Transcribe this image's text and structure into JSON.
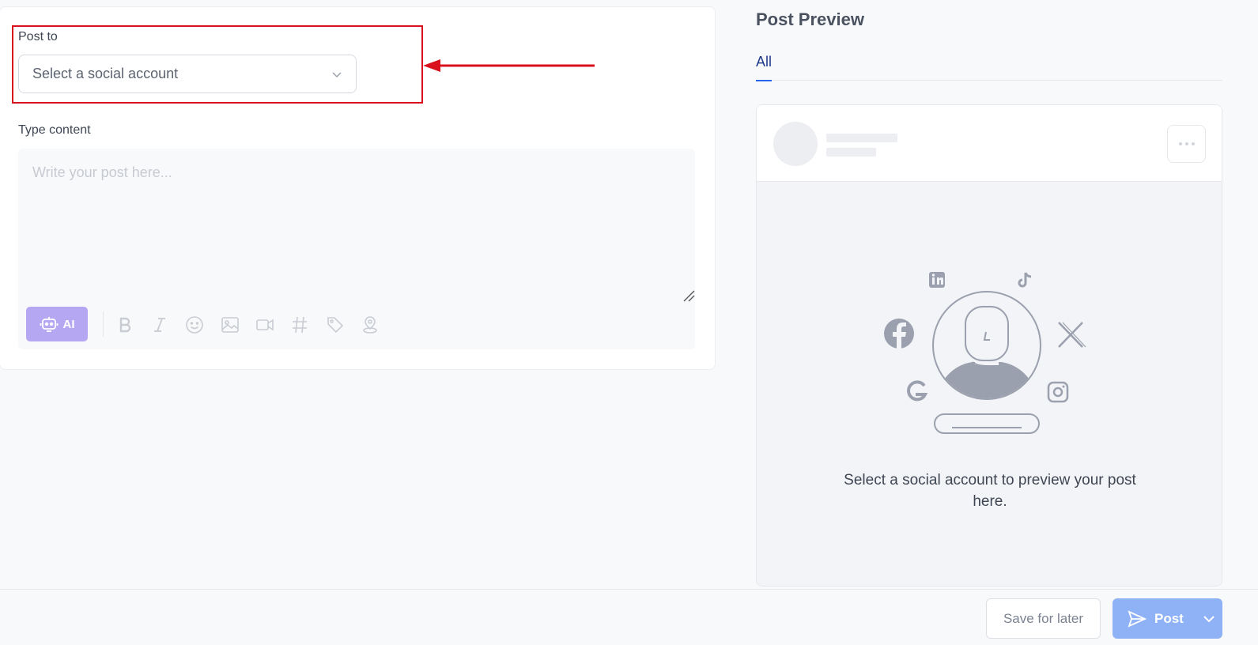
{
  "composer": {
    "post_to_label": "Post to",
    "account_select_value": "Select a social account",
    "type_content_label": "Type content",
    "editor_placeholder": "Write your post here...",
    "ai_button_label": "AI",
    "toolbar_icons": [
      "bold-icon",
      "italic-icon",
      "emoji-icon",
      "image-icon",
      "video-icon",
      "hashtag-icon",
      "tag-icon",
      "location-icon"
    ]
  },
  "annotation": {
    "highlight_color": "#d9101d"
  },
  "preview": {
    "title": "Post Preview",
    "tabs": [
      {
        "label": "All",
        "active": true
      }
    ],
    "empty_message": "Select a social account to preview your post here.",
    "social_icons": [
      "linkedin-icon",
      "tiktok-icon",
      "facebook-icon",
      "x-icon",
      "google-icon",
      "instagram-icon"
    ]
  },
  "footer": {
    "save_later_label": "Save for later",
    "post_label": "Post"
  },
  "colors": {
    "accent": "#2563eb",
    "ai_purple": "#b6a7f3",
    "post_blue": "#8fb1f5"
  }
}
